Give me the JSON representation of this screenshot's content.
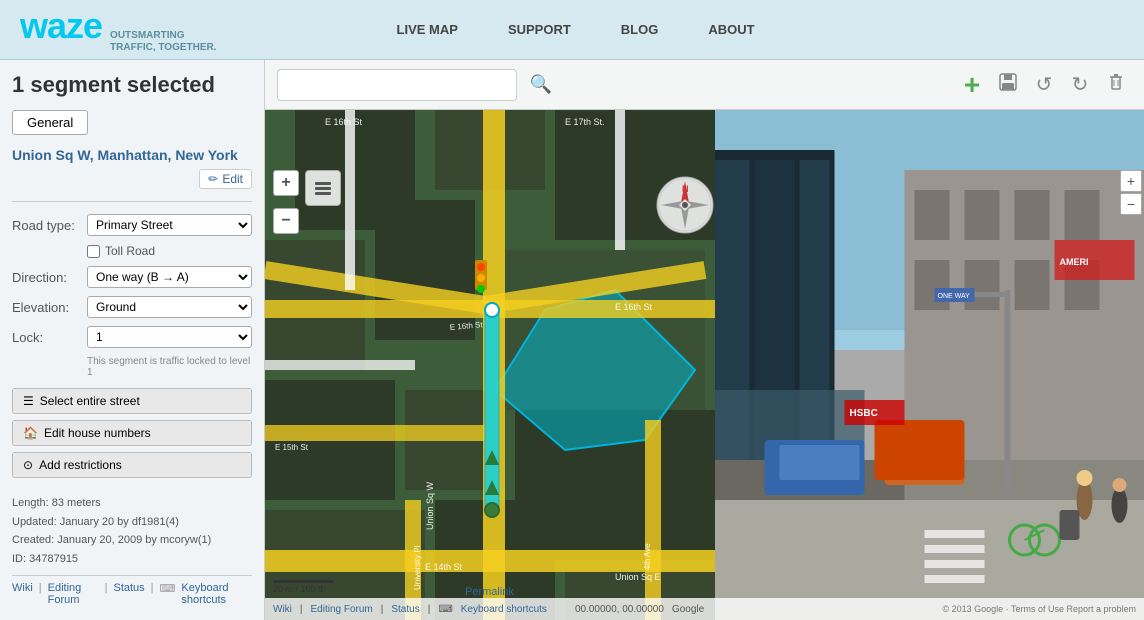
{
  "header": {
    "logo_text": "waze",
    "tagline_line1": "OUTSMARTING",
    "tagline_line2": "TRAFFIC, TOGETHER.",
    "nav": [
      {
        "id": "live-map",
        "label": "LIVE MAP"
      },
      {
        "id": "support",
        "label": "SUPPORT"
      },
      {
        "id": "blog",
        "label": "BLOG"
      },
      {
        "id": "about",
        "label": "ABOUT"
      }
    ]
  },
  "sidebar": {
    "title": "1 segment selected",
    "tab_general": "General",
    "street_name": "Union Sq W, Manhattan, New York",
    "edit_button": "Edit",
    "road_type_label": "Road type:",
    "road_type_value": "Primary Street",
    "toll_road_label": "Toll Road",
    "direction_label": "Direction:",
    "direction_value": "One way (B → A)",
    "elevation_label": "Elevation:",
    "elevation_value": "Ground",
    "lock_label": "Lock:",
    "lock_value": "1",
    "lock_note": "This segment is traffic locked to level 1",
    "btn_select_street": "Select entire street",
    "btn_edit_house": "Edit house numbers",
    "btn_add_restrictions": "Add restrictions",
    "footer": {
      "length": "Length: 83 meters",
      "updated": "Updated: January 20 by df1981(4)",
      "created": "Created: January 20, 2009 by mcoryw(1)",
      "id": "ID: 34787915"
    },
    "bottom_links": [
      {
        "id": "wiki",
        "label": "Wiki"
      },
      {
        "id": "editing-forum",
        "label": "Editing Forum"
      },
      {
        "id": "status",
        "label": "Status"
      },
      {
        "id": "keyboard-shortcuts",
        "label": "Keyboard shortcuts"
      }
    ]
  },
  "toolbar": {
    "search_placeholder": "",
    "search_icon": "🔍",
    "add_icon": "+",
    "save_icon": "💾",
    "undo_icon": "↺",
    "redo_icon": "↻",
    "delete_icon": "🗑"
  },
  "map": {
    "compass": "N",
    "zoom_in": "+",
    "zoom_out": "−",
    "permalink_label": "Permalink",
    "coords": "00.00000, 00.00000",
    "scale_20m": "20 m",
    "scale_100ft": "100 ft",
    "copyright": "© 2013 Google · Terms of Use  Report a problem"
  },
  "bottom_bar": {
    "wiki_link": "Wiki",
    "editing_forum_link": "Editing Forum",
    "status_link": "Status",
    "keyboard_link": "Keyboard shortcuts"
  }
}
